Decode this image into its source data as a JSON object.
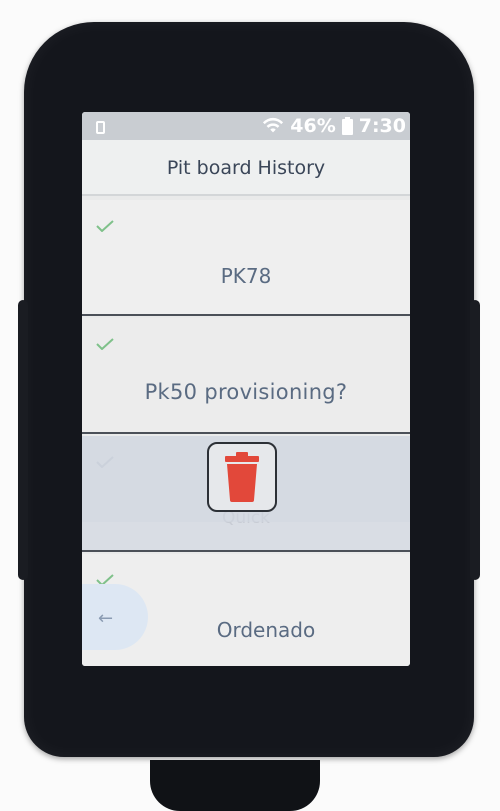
{
  "status_bar": {
    "battery_percent": "46%",
    "time": "7:30",
    "icons": [
      "sim-icon",
      "wifi-icon",
      "battery-icon"
    ]
  },
  "header": {
    "title": "Pit board History"
  },
  "history_items": [
    {
      "label": "PK78",
      "icon": "check-icon"
    },
    {
      "label": "Pk50 provisioning?",
      "icon": "check-icon"
    },
    {
      "label": "Quick",
      "icon": "check-icon"
    },
    {
      "label": "Ordenado",
      "icon": "check-icon"
    }
  ],
  "actions": {
    "delete_icon": "trash-icon",
    "back_icon": "back-arrow-icon",
    "back_glyph": "←"
  },
  "colors": {
    "check": "#7fc18a",
    "trash": "#e2483a",
    "label": "#5a6b82",
    "device": "#14161c"
  }
}
